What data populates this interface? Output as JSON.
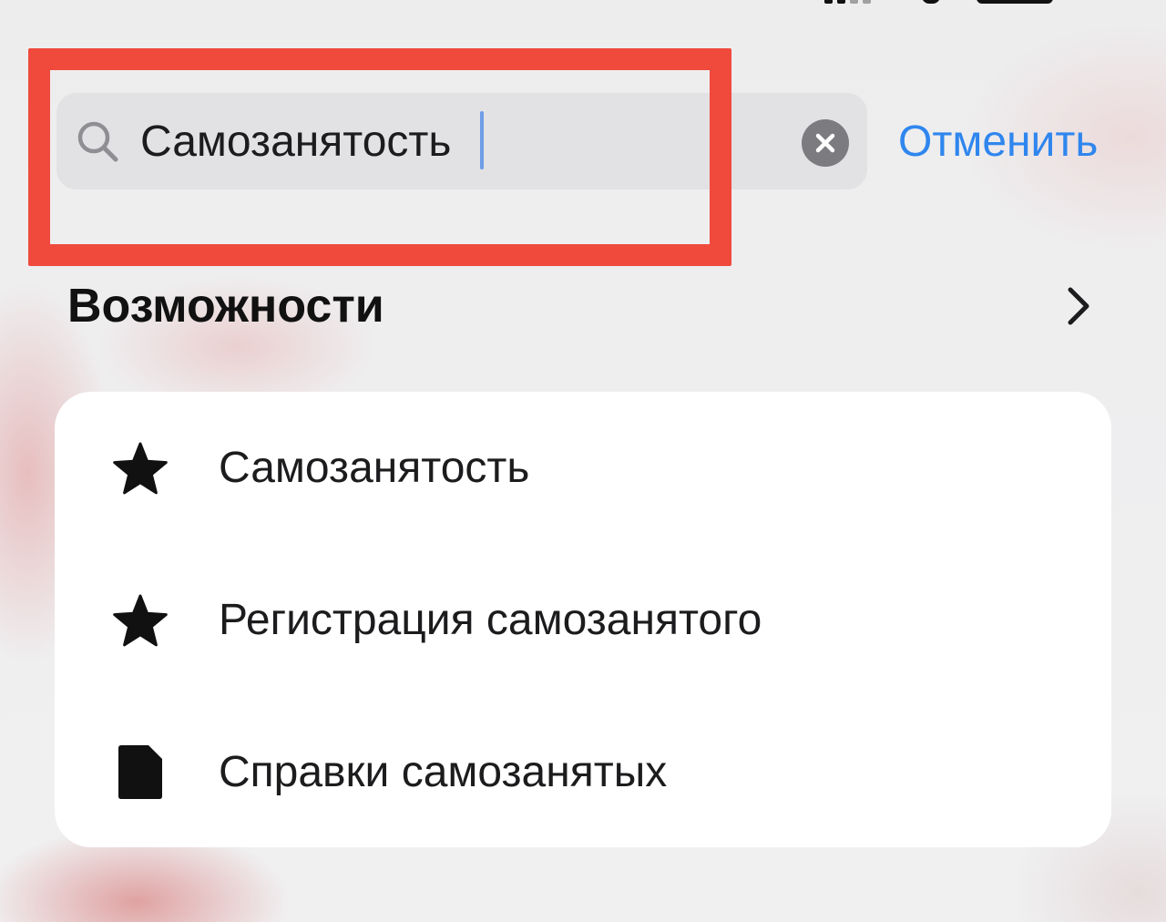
{
  "search": {
    "value": "Самозанятость",
    "cancel_label": "Отменить"
  },
  "section": {
    "title": "Возможности"
  },
  "results": [
    {
      "label": "Самозанятость",
      "icon": "star-icon"
    },
    {
      "label": "Регистрация самозанятого",
      "icon": "star-icon"
    },
    {
      "label": "Справки самозанятых",
      "icon": "document-icon"
    }
  ],
  "colors": {
    "accent": "#2f86ee",
    "highlight": "#f04a3d",
    "field_background": "#e2e2e4"
  }
}
